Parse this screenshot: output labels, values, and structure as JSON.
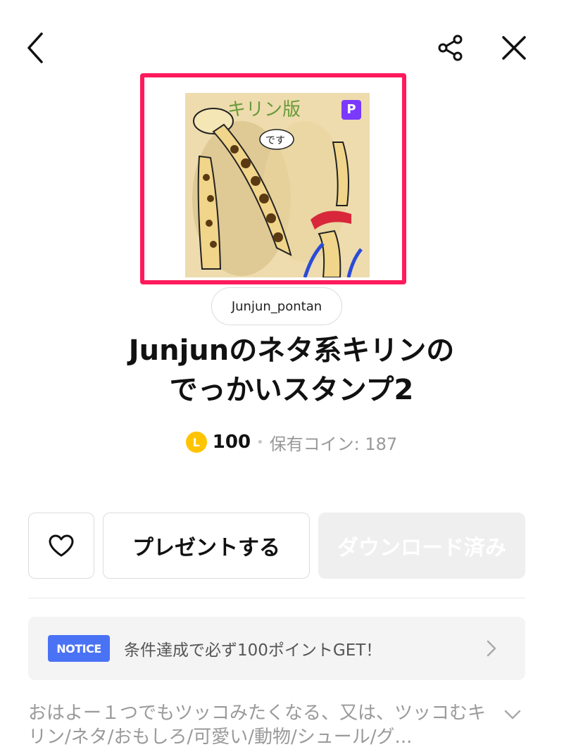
{
  "header": {
    "back_icon": "chevron-left-icon",
    "share_icon": "share-icon",
    "close_icon": "close-icon"
  },
  "sticker": {
    "premium_badge": "P",
    "author": "Junjun_pontan",
    "title_line1": "Junjunのネタ系キリンの",
    "title_line2": "でっかいスタンプ2",
    "coin_symbol": "L",
    "price": "100",
    "separator": "•",
    "owned_coins": "保有コイン: 187"
  },
  "actions": {
    "like_icon": "heart-icon",
    "gift_label": "プレゼントする",
    "download_label": "ダウンロード済み"
  },
  "notice": {
    "badge": "NOTICE",
    "text": "条件達成で必ず100ポイントGET！"
  },
  "description": {
    "text": "おはよー１つでもツッコみたくなる、又は、ツッコむキリン/ネタ/おもしろ/可愛い/動物/シュール/グ..."
  },
  "colors": {
    "highlight_frame": "#ff1a5c",
    "notice_badge": "#4a72f5",
    "coin": "#ffc400",
    "premium": "#7b39ff"
  }
}
